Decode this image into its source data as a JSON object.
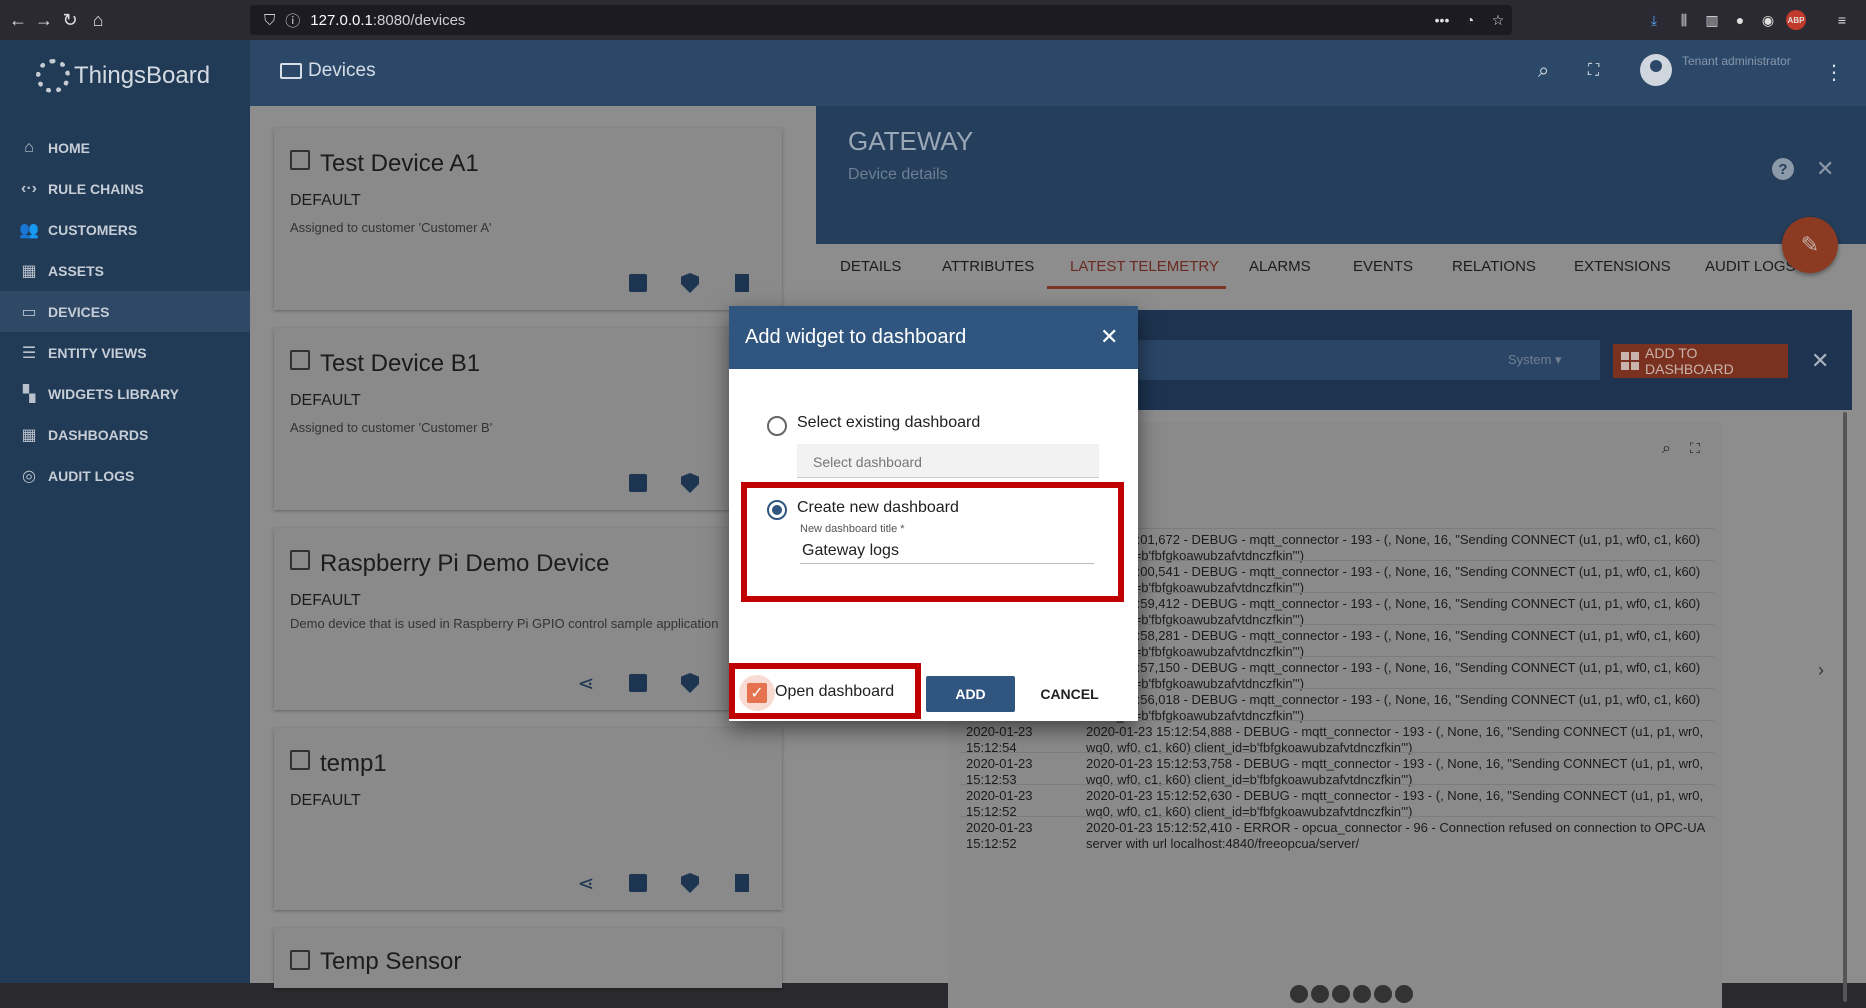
{
  "browser": {
    "url_host": "127.0.0.1",
    "url_path": ":8080/devices",
    "abp_label": "ABP"
  },
  "sidebar": {
    "logo": "ThingsBoard",
    "items": [
      {
        "label": "HOME",
        "icon": "home-icon"
      },
      {
        "label": "RULE CHAINS",
        "icon": "rule-chains-icon"
      },
      {
        "label": "CUSTOMERS",
        "icon": "customers-icon"
      },
      {
        "label": "ASSETS",
        "icon": "assets-icon"
      },
      {
        "label": "DEVICES",
        "icon": "devices-icon"
      },
      {
        "label": "ENTITY VIEWS",
        "icon": "entity-views-icon"
      },
      {
        "label": "WIDGETS LIBRARY",
        "icon": "widgets-library-icon"
      },
      {
        "label": "DASHBOARDS",
        "icon": "dashboards-icon"
      },
      {
        "label": "AUDIT LOGS",
        "icon": "audit-logs-icon"
      }
    ]
  },
  "topbar": {
    "title": "Devices",
    "user_role": "Tenant administrator"
  },
  "devices": [
    {
      "name": "Test Device A1",
      "type": "DEFAULT",
      "desc": "Assigned to customer 'Customer A'"
    },
    {
      "name": "Test Device B1",
      "type": "DEFAULT",
      "desc": "Assigned to customer 'Customer B'"
    },
    {
      "name": "Raspberry Pi Demo Device",
      "type": "DEFAULT",
      "desc": "Demo device that is used in Raspberry Pi GPIO control sample application"
    },
    {
      "name": "temp1",
      "type": "DEFAULT",
      "desc": ""
    },
    {
      "name": "Temp Sensor",
      "type": "",
      "desc": ""
    }
  ],
  "panel": {
    "title": "GATEWAY",
    "subtitle": "Device details",
    "tabs": [
      "DETAILS",
      "ATTRIBUTES",
      "LATEST TELEMETRY",
      "ALARMS",
      "EVENTS",
      "RELATIONS",
      "EXTENSIONS",
      "AUDIT LOGS"
    ],
    "active_tab": "LATEST TELEMETRY",
    "system_select": "System",
    "add_to_dashboard": "ADD TO DASHBOARD"
  },
  "logs": [
    {
      "ts": "",
      "value": "23 15:13:01,672 - DEBUG - mqtt_connector - 193 - (, None, 16, \"Sending CONNECT (u1, p1, wf0, c1, k60) client_id=b'fbfgkoawubzafvtdnczfkin'\")"
    },
    {
      "ts": "",
      "value": "23 15:13:00,541 - DEBUG - mqtt_connector - 193 - (, None, 16, \"Sending CONNECT (u1, p1, wf0, c1, k60) client_id=b'fbfgkoawubzafvtdnczfkin'\")"
    },
    {
      "ts": "",
      "value": "23 15:12:59,412 - DEBUG - mqtt_connector - 193 - (, None, 16, \"Sending CONNECT (u1, p1, wf0, c1, k60) client_id=b'fbfgkoawubzafvtdnczfkin'\")"
    },
    {
      "ts": "",
      "value": "23 15:12:58,281 - DEBUG - mqtt_connector - 193 - (, None, 16, \"Sending CONNECT (u1, p1, wf0, c1, k60) client_id=b'fbfgkoawubzafvtdnczfkin'\")"
    },
    {
      "ts": "",
      "value": "23 15:12:57,150 - DEBUG - mqtt_connector - 193 - (, None, 16, \"Sending CONNECT (u1, p1, wf0, c1, k60) client_id=b'fbfgkoawubzafvtdnczfkin'\")"
    },
    {
      "ts": "",
      "value": "23 15:12:56,018 - DEBUG - mqtt_connector - 193 - (, None, 16, \"Sending CONNECT (u1, p1, wf0, c1, k60) client_id=b'fbfgkoawubzafvtdnczfkin'\")"
    },
    {
      "ts": "2020-01-23 15:12:54",
      "value": "2020-01-23 15:12:54,888 - DEBUG - mqtt_connector - 193 - (, None, 16, \"Sending CONNECT (u1, p1, wr0, wq0, wf0, c1, k60) client_id=b'fbfgkoawubzafvtdnczfkin'\")"
    },
    {
      "ts": "2020-01-23 15:12:53",
      "value": "2020-01-23 15:12:53,758 - DEBUG - mqtt_connector - 193 - (, None, 16, \"Sending CONNECT (u1, p1, wr0, wq0, wf0, c1, k60) client_id=b'fbfgkoawubzafvtdnczfkin'\")"
    },
    {
      "ts": "2020-01-23 15:12:52",
      "value": "2020-01-23 15:12:52,630 - DEBUG - mqtt_connector - 193 - (, None, 16, \"Sending CONNECT (u1, p1, wr0, wq0, wf0, c1, k60) client_id=b'fbfgkoawubzafvtdnczfkin'\")"
    },
    {
      "ts": "2020-01-23 15:12:52",
      "value": "2020-01-23 15:12:52,410 - ERROR - opcua_connector - 96 - Connection refused on connection to OPC-UA server with url localhost:4840/freeopcua/server/"
    }
  ],
  "dialog": {
    "title": "Add widget to dashboard",
    "opt_existing": "Select existing dashboard",
    "select_placeholder": "Select dashboard",
    "opt_new": "Create new dashboard",
    "new_title_label": "New dashboard title *",
    "new_title_value": "Gateway logs",
    "open_dashboard": "Open dashboard",
    "add": "ADD",
    "cancel": "CANCEL"
  },
  "colors": {
    "highlight": "#c00000",
    "primary": "#305680",
    "accent": "#e5734f"
  }
}
